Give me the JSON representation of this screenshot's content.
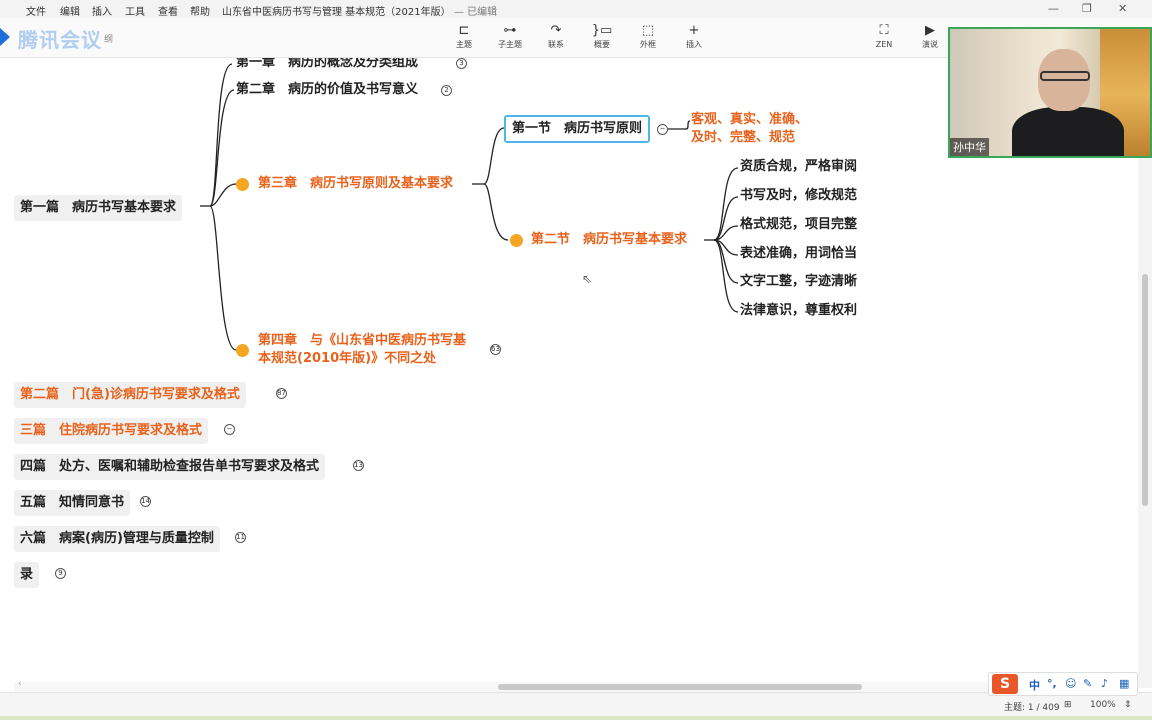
{
  "menu": {
    "items": [
      "文件",
      "编辑",
      "插入",
      "工具",
      "查看",
      "帮助"
    ]
  },
  "document": {
    "title": "山东省中医病历书写与管理 基本规范（2021年版）",
    "save_status": "— 已编辑"
  },
  "watermark": {
    "text": "腾讯会议",
    "suffix": "纲"
  },
  "toolbar": {
    "items": [
      {
        "label": "主题",
        "icon": "topic-icon"
      },
      {
        "label": "子主题",
        "icon": "subtopic-icon"
      },
      {
        "label": "联系",
        "icon": "relationship-icon"
      },
      {
        "label": "概要",
        "icon": "summary-icon"
      },
      {
        "label": "外框",
        "icon": "boundary-icon"
      },
      {
        "label": "插入",
        "icon": "plus-icon"
      }
    ],
    "right_items": [
      {
        "label": "ZEN",
        "icon": "fullscreen-icon"
      },
      {
        "label": "演说",
        "icon": "present-icon"
      }
    ]
  },
  "mindmap": {
    "root": "第一篇　病历书写基本要求",
    "chapters": [
      {
        "label": "第一章　病历的概念及分类组成",
        "count": "3"
      },
      {
        "label": "第二章　病历的价值及书写意义",
        "count": "2"
      },
      {
        "label": "第三章　病历书写原则及基本要求"
      },
      {
        "label_line1": "第四章　与《山东省中医病历书写基",
        "label_line2": "本规范(2010年版)》不同之处",
        "count": "63"
      }
    ],
    "section1": {
      "label": "第一节　病历书写原则",
      "detail_line1": "客观、真实、准确、",
      "detail_line2": "及时、完整、规范"
    },
    "section2": {
      "label": "第二节　病历书写基本要求",
      "items": [
        "资质合规，严格审阅",
        "书写及时，修改规范",
        "格式规范，项目完整",
        "表述准确，用词恰当",
        "文字工整，字迹清晰",
        "法律意识，尊重权利"
      ]
    },
    "parts": [
      {
        "label": "第二篇　门(急)诊病历书写要求及格式",
        "count": "87"
      },
      {
        "label": "三篇　住院病历书写要求及格式",
        "count": ""
      },
      {
        "label": "四篇　处方、医嘱和辅助检查报告单书写要求及格式",
        "count": "13"
      },
      {
        "label": "五篇　知情同意书",
        "count": "14"
      },
      {
        "label": "六篇　病案(病历)管理与质量控制",
        "count": "11"
      },
      {
        "label": "录",
        "count": "9"
      }
    ]
  },
  "status": {
    "topic_count": "主题: 1 / 409",
    "zoom": "100%"
  },
  "ime": {
    "logo": "S",
    "mode": "中",
    "punct": "°,"
  },
  "video": {
    "participant_name": "孙中华"
  },
  "colors": {
    "accent": "#e8621c",
    "bullet": "#f5a623",
    "selection": "#4fb6ea",
    "video_border": "#3aa657"
  }
}
